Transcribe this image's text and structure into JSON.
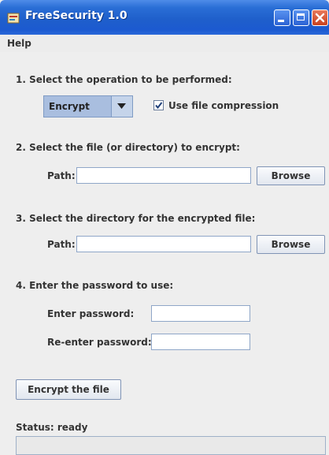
{
  "window": {
    "title": "FreeSecurity 1.0",
    "controls": [
      "minimize",
      "maximize",
      "close"
    ]
  },
  "menu": {
    "items": [
      "Help"
    ]
  },
  "step1": {
    "heading": "1. Select the operation to be performed:",
    "operation_selected": "Encrypt",
    "compression_label": "Use file compression",
    "compression_checked": true
  },
  "step2": {
    "heading": "2. Select the file (or directory) to encrypt:",
    "path_label": "Path:",
    "path_value": "",
    "browse_label": "Browse"
  },
  "step3": {
    "heading": "3. Select the directory for the encrypted file:",
    "path_label": "Path:",
    "path_value": "",
    "browse_label": "Browse"
  },
  "step4": {
    "heading": "4. Enter the password to use:",
    "password_label": "Enter password:",
    "reenter_label": "Re-enter password:"
  },
  "action": {
    "button_label": "Encrypt the file"
  },
  "status": {
    "text": "Status: ready"
  },
  "colors": {
    "titlebar": "#1f5fcb",
    "combo": "#a9bedf",
    "background": "#eeeeee"
  }
}
